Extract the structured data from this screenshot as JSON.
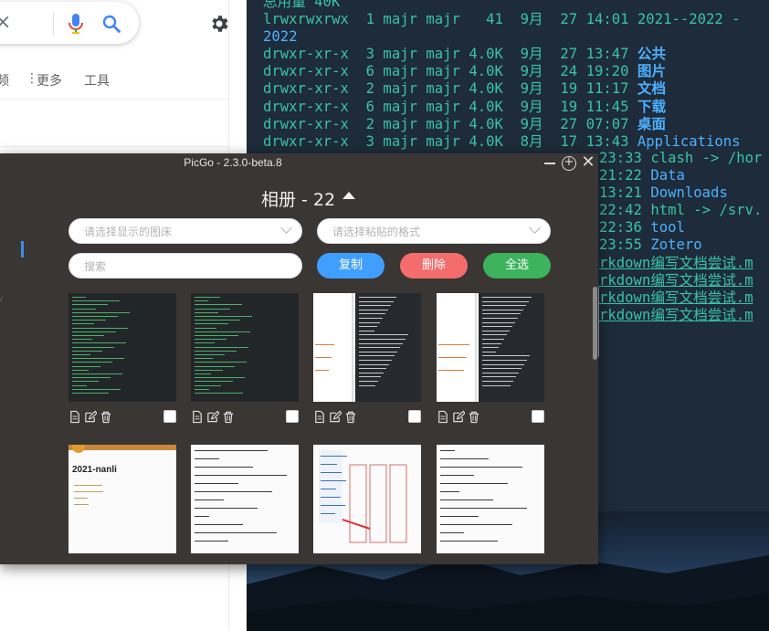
{
  "browser": {
    "clear_icon": "×",
    "nav_items": [
      {
        "label": "频",
        "icon": ""
      },
      {
        "label": "更多",
        "icon": "⋮"
      },
      {
        "label": "工具",
        "icon": ""
      }
    ]
  },
  "terminal": {
    "lines_top": [
      {
        "perm": "总用量 40K",
        "rest": ""
      },
      {
        "perm": "lrwxrwxrwx  1 majr majr   41  9月  27 14:01 ",
        "name": "2021--2022 -",
        "kind": "link"
      },
      {
        "perm": "2022",
        "name": "",
        "kind": "plain"
      },
      {
        "perm": "drwxr-xr-x  3 majr majr 4.0K  9月  27 13:47 ",
        "name": "公共",
        "kind": "dir"
      },
      {
        "perm": "drwxr-xr-x  6 majr majr 4.0K  9月  24 19:20 ",
        "name": "图片",
        "kind": "dir"
      },
      {
        "perm": "drwxr-xr-x  2 majr majr 4.0K  9月  19 11:17 ",
        "name": "文档",
        "kind": "dir"
      },
      {
        "perm": "drwxr-xr-x  6 majr majr 4.0K  9月  19 11:45 ",
        "name": "下载",
        "kind": "dir"
      },
      {
        "perm": "drwxr-xr-x  2 majr majr 4.0K  9月  27 07:07 ",
        "name": "桌面",
        "kind": "dir"
      },
      {
        "perm": "drwxr-xr-x  3 majr majr 4.0K  8月  17 13:43 ",
        "name": "Applications",
        "kind": "plain"
      }
    ],
    "lines_right": [
      {
        "time": "23:33 ",
        "name": "clash -> /hor",
        "kind": "link"
      },
      {
        "time": "21:22 ",
        "name": "Data",
        "kind": "plain"
      },
      {
        "time": "13:21 ",
        "name": "Downloads",
        "kind": "plain"
      },
      {
        "time": "22:42 ",
        "name": "html -> /srv.",
        "kind": "link"
      },
      {
        "time": "22:36 ",
        "name": "tool",
        "kind": "plain"
      },
      {
        "time": "23:55 ",
        "name": "Zotero",
        "kind": "plain"
      },
      {
        "time": "",
        "name": "rkdown编写文档尝试.m",
        "kind": "md"
      },
      {
        "time": "",
        "name": "rkdown编写文档尝试.m",
        "kind": "md"
      },
      {
        "time": "",
        "name": "rkdown编写文档尝试.m",
        "kind": "md"
      },
      {
        "time": "",
        "name": "rkdown编写文档尝试.m",
        "kind": "md"
      }
    ]
  },
  "picgo": {
    "window_title": "PicGo - 2.3.0-beta.8",
    "close_glyph": "✕",
    "pin_glyph": "+",
    "heading": "相册 - 22",
    "select_bed_placeholder": "请选择显示的图床",
    "select_format_placeholder": "请选择粘贴的格式",
    "search_placeholder": "搜索",
    "buttons": {
      "copy": "复制",
      "delete": "删除",
      "select_all": "全选"
    },
    "colors": {
      "copy": "#409eff",
      "delete": "#f56c6c",
      "select_all": "#3cb35c",
      "window_bg": "#3a3633"
    },
    "gallery": [
      {
        "style": "dark-terminal"
      },
      {
        "style": "dark-terminal"
      },
      {
        "style": "split-doc"
      },
      {
        "style": "split-doc"
      },
      {
        "style": "doc-title",
        "title_text": "2021-nanli"
      },
      {
        "style": "doc-text"
      },
      {
        "style": "doc-diagram"
      },
      {
        "style": "doc-text"
      }
    ]
  }
}
